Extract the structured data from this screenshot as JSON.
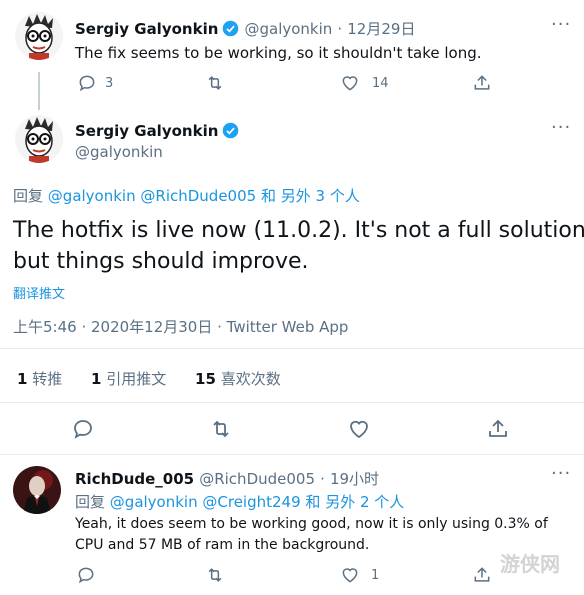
{
  "tweet1": {
    "name": "Sergiy Galyonkin",
    "handle": "@galyonkin",
    "sep": "·",
    "date": "12月29日",
    "text": "The fix seems to be working, so it shouldn't take long.",
    "reply_count": "3",
    "like_count": "14"
  },
  "tweet2": {
    "name": "Sergiy Galyonkin",
    "handle": "@galyonkin",
    "reply_label": "回复",
    "reply_to_1": "@galyonkin",
    "reply_to_2": "@RichDude005",
    "reply_and": "和",
    "reply_others": "另外 3 个人",
    "text_line1": "The hotfix is live now (11.0.2). It's not a full solution,",
    "text_line2": "but things should improve.",
    "translate": "翻译推文",
    "timestamp": "上午5:46 · 2020年12月30日 · Twitter Web App",
    "retweets_num": "1",
    "retweets_label": "转推",
    "quotes_num": "1",
    "quotes_label": "引用推文",
    "likes_num": "15",
    "likes_label": "喜欢次数"
  },
  "tweet3": {
    "name": "RichDude_005",
    "handle": "@RichDude005",
    "sep": "·",
    "time": "19小时",
    "reply_label": "回复",
    "reply_to_1": "@galyonkin",
    "reply_to_2": "@Creight249",
    "reply_and": "和",
    "reply_others": "另外 2 个人",
    "text_line1": "Yeah, it does seem to be working good, now it is only using 0.3% of",
    "text_line2": "CPU and 57 MB of ram in the background.",
    "like_count": "1"
  },
  "watermark": "游侠网",
  "colors": {
    "accent": "#1da1f2",
    "link": "#1b95e0",
    "muted": "#5b7083",
    "divider": "#e6ecf0"
  },
  "icons": [
    "reply-icon",
    "retweet-icon",
    "like-icon",
    "share-icon",
    "verified-badge-icon",
    "more-icon"
  ]
}
